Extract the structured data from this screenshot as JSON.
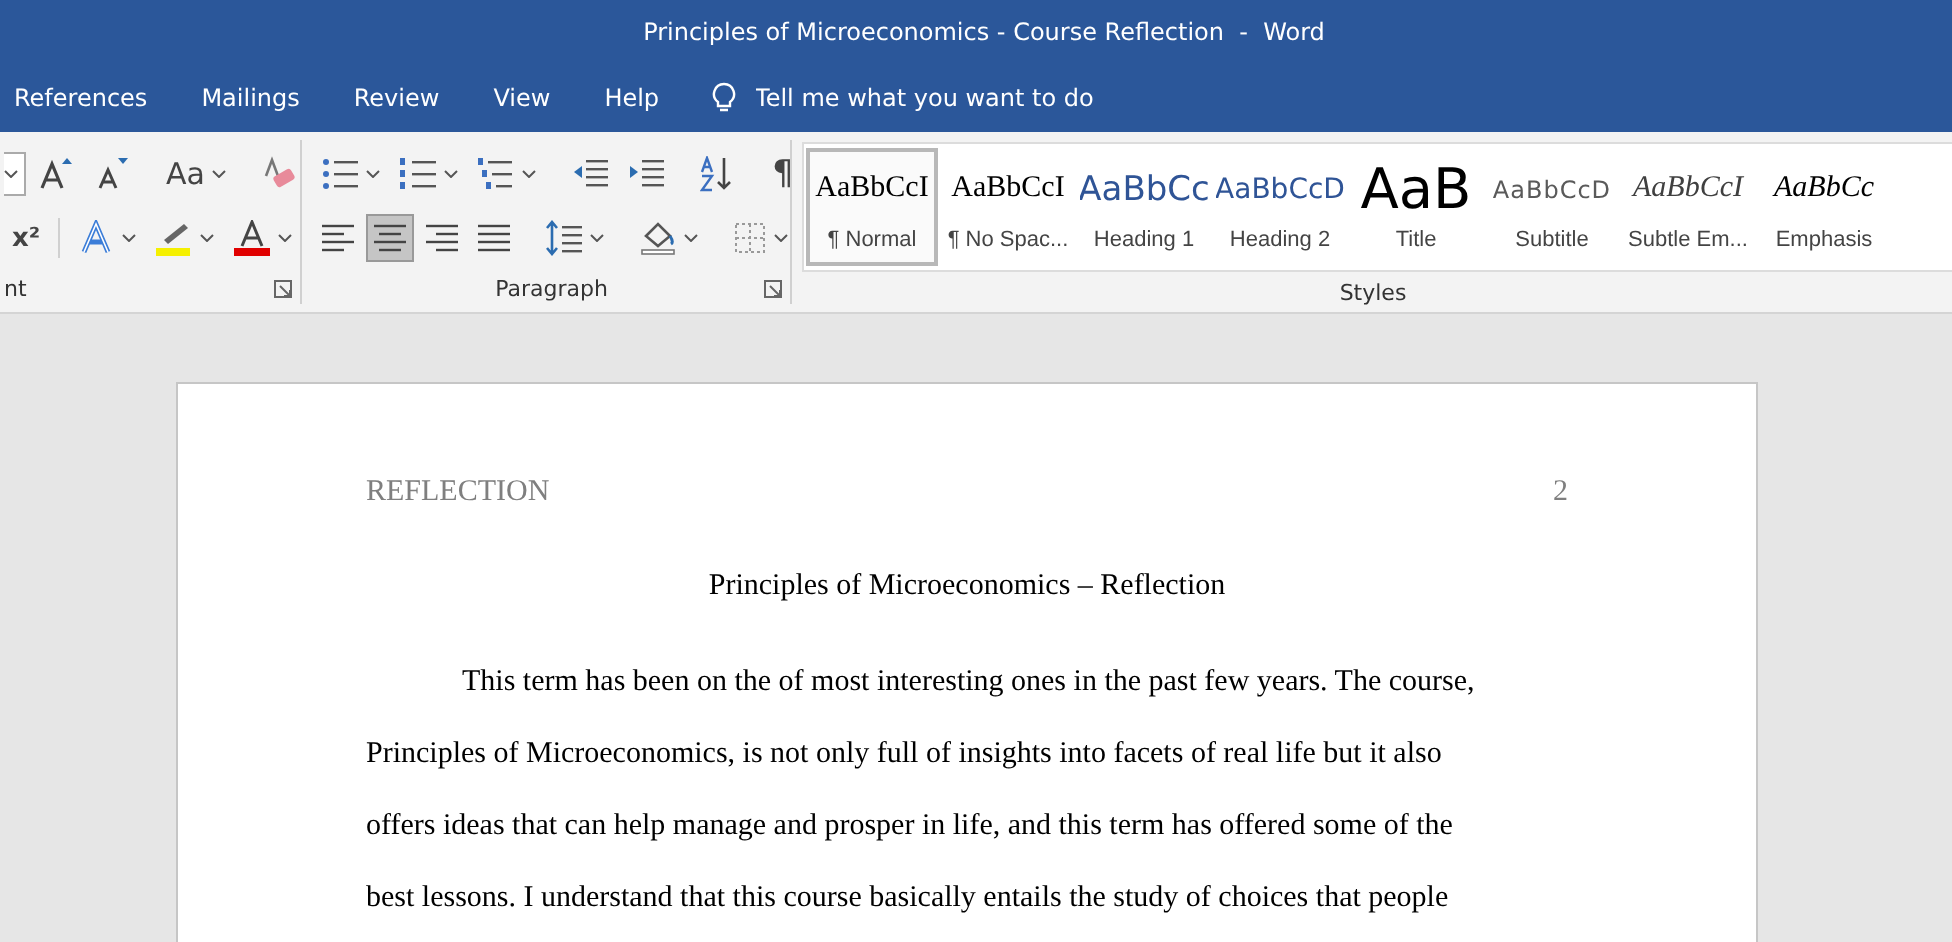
{
  "window": {
    "title": "Principles of Microeconomics - Course Reflection  -  Word"
  },
  "ribbon_tabs": [
    {
      "label": "References",
      "selected": false
    },
    {
      "label": "Mailings",
      "selected": false
    },
    {
      "label": "Review",
      "selected": false
    },
    {
      "label": "View",
      "selected": false
    },
    {
      "label": "Help",
      "selected": false
    }
  ],
  "tell_me": {
    "placeholder": "Tell me what you want to do"
  },
  "font_group": {
    "label": "nt",
    "row1": [
      {
        "kind": "size-dropdown"
      },
      {
        "kind": "grow"
      },
      {
        "kind": "shrink"
      },
      {
        "kind": "case",
        "glyph": "Aa"
      },
      {
        "kind": "clear"
      }
    ],
    "row2": [
      {
        "kind": "superscript",
        "glyph": "x²"
      },
      {
        "kind": "effects"
      },
      {
        "kind": "highlight"
      },
      {
        "kind": "fontcolor"
      }
    ]
  },
  "paragraph_group": {
    "label": "Paragraph",
    "row1": [
      {
        "kind": "bullets"
      },
      {
        "kind": "numbering"
      },
      {
        "kind": "multilevel"
      },
      {
        "kind": "outdent"
      },
      {
        "kind": "indent"
      },
      {
        "kind": "sort"
      },
      {
        "kind": "pilcrow",
        "glyph": "¶"
      }
    ],
    "alignment": [
      {
        "kind": "left",
        "selected": false
      },
      {
        "kind": "center",
        "selected": true
      },
      {
        "kind": "right",
        "selected": false
      },
      {
        "kind": "justify",
        "selected": false
      }
    ],
    "row2": [
      {
        "kind": "spacing"
      },
      {
        "kind": "shading"
      },
      {
        "kind": "borders"
      }
    ]
  },
  "styles_group": {
    "label": "Styles",
    "items": [
      {
        "kind": "normal",
        "preview": "AaBbCcI",
        "name": "¶ Normal",
        "selected": true
      },
      {
        "kind": "nospacing",
        "preview": "AaBbCcI",
        "name": "¶ No Spac...",
        "selected": false
      },
      {
        "kind": "heading1",
        "preview": "AaBbCc",
        "name": "Heading 1",
        "selected": false
      },
      {
        "kind": "heading2",
        "preview": "AaBbCcD",
        "name": "Heading 2",
        "selected": false
      },
      {
        "kind": "title",
        "preview": "AaB",
        "name": "Title",
        "selected": false
      },
      {
        "kind": "subtitle",
        "preview": "AaBbCcD",
        "name": "Subtitle",
        "selected": false
      },
      {
        "kind": "subtle",
        "preview": "AaBbCcI",
        "name": "Subtle Em...",
        "selected": false
      },
      {
        "kind": "emphasis",
        "preview": "AaBbCc",
        "name": "Emphasis",
        "selected": false
      }
    ]
  },
  "document": {
    "header": "REFLECTION",
    "page_number": "2",
    "title": "Principles of Microeconomics – Reflection",
    "paragraph_lines": [
      "This term has been on the of most interesting ones in the past few years. The course,",
      "Principles of Microeconomics, is not only full of insights into facets of real life but it also",
      "offers ideas that can help manage and prosper in life, and this term has offered some of the",
      "best lessons. I understand that this course basically entails the study of choices that people"
    ]
  }
}
